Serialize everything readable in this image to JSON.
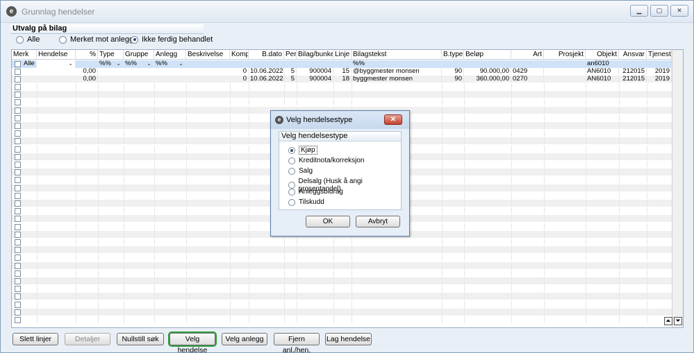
{
  "window": {
    "title": "Grunnlag hendelser",
    "app_icon": "e-logo-icon",
    "controls": [
      "minimize-icon",
      "maximize-icon",
      "close-icon"
    ]
  },
  "filter": {
    "header": "Utvalg på bilag",
    "options": [
      {
        "label": "Alle",
        "selected": false
      },
      {
        "label": "Merket mot anlegg",
        "selected": false
      },
      {
        "label": "Ikke ferdig behandlet",
        "selected": true
      }
    ]
  },
  "grid": {
    "columns": [
      "Merk",
      "Hendelse",
      "%",
      "Type",
      "Gruppe",
      "Anlegg",
      "Beskrivelse",
      "Komp",
      "B.dato",
      "Per.",
      "Bilag/bunke",
      "Linje",
      "Bilagstekst",
      "B.type",
      "Beløp",
      "Art",
      "Prosjekt",
      "Objekt",
      "Ansvar",
      "Tjeneste"
    ],
    "filter_row": {
      "merk": "Alle",
      "type": "%%",
      "gruppe": "%%",
      "anlegg": "%%",
      "bilagstekst": "%%",
      "objekt": "an6010"
    },
    "rows": [
      {
        "pct": "0,00",
        "komp": "0",
        "bdato": "10.06.2022",
        "per": "5",
        "bilag": "900004",
        "linje": "15",
        "tekst": "@byggmester monsen",
        "btype": "90",
        "belop": "90.000,00",
        "art": "0429",
        "prosjekt": "",
        "objekt": "AN6010",
        "ansvar": "212015",
        "tjeneste": "2019"
      },
      {
        "pct": "0,00",
        "komp": "0",
        "bdato": "10.06.2022",
        "per": "5",
        "bilag": "900004",
        "linje": "18",
        "tekst": "byggmester monsen",
        "btype": "90",
        "belop": "360.000,00",
        "art": "0270",
        "prosjekt": "",
        "objekt": "AN6010",
        "ansvar": "212015",
        "tjeneste": "2019"
      }
    ]
  },
  "buttons": {
    "slett": "Slett linjer",
    "detaljer": "Detaljer",
    "nullstill": "Nullstill søk",
    "velg_hendelse": "Velg hendelse",
    "velg_anlegg": "Velg anlegg",
    "fjern": "Fjern anl./hen.",
    "lag": "Lag hendelse"
  },
  "dialog": {
    "title": "Velg hendelsestype",
    "group_header": "Velg hendelsestype",
    "options": [
      {
        "label": "Kjøp",
        "selected": true
      },
      {
        "label": "Kreditnota/korreksjon",
        "selected": false
      },
      {
        "label": "Salg",
        "selected": false
      },
      {
        "label": "Delsalg (Husk å angi prosentandel)",
        "selected": false
      },
      {
        "label": "Anleggsbidrag",
        "selected": false
      },
      {
        "label": "Tilskudd",
        "selected": false
      }
    ],
    "ok": "OK",
    "cancel": "Avbryt"
  },
  "colors": {
    "filter_row_bg": "#cfe2f7",
    "stripe_bg": "#f0f0f0",
    "active_outline": "#2e9b3b",
    "dialog_close": "#c4402a"
  }
}
